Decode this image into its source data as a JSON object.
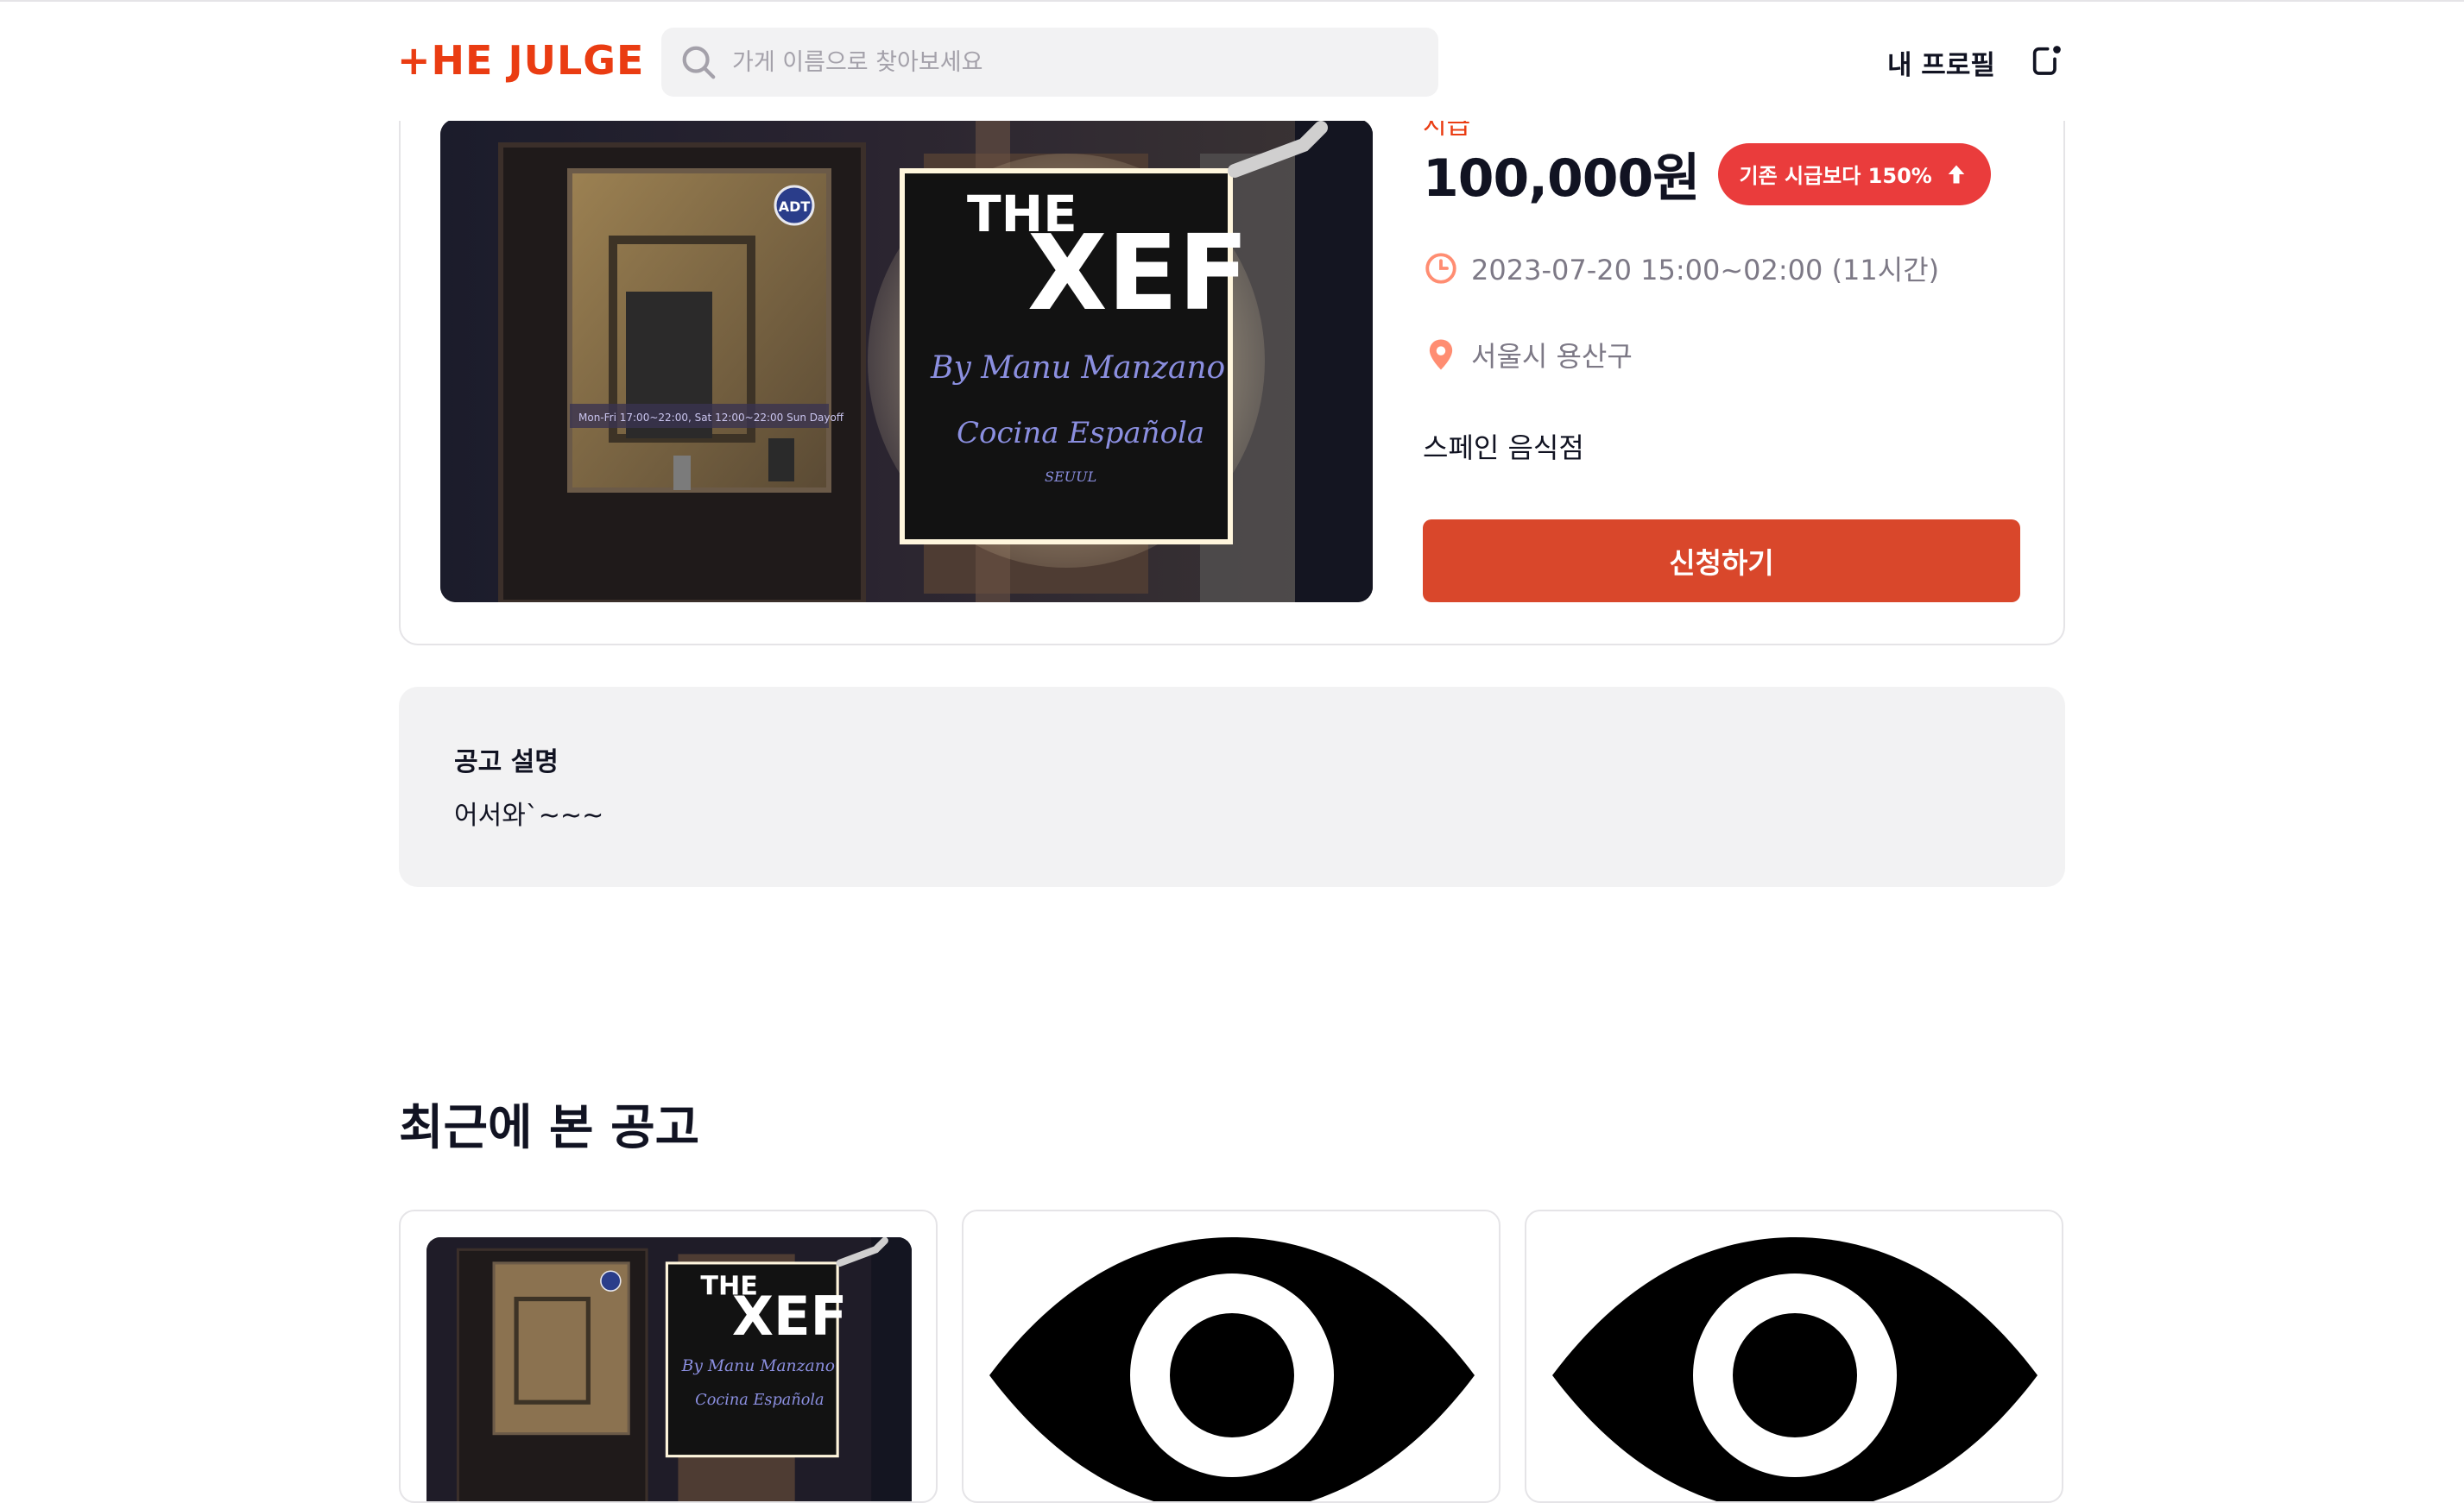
{
  "header": {
    "logo_text": "+HE JULGE",
    "search_placeholder": "가게 이름으로 찾아보세요",
    "profile_label": "내 프로필",
    "brand_color": "#ea3c12"
  },
  "post": {
    "wage_label": "시급",
    "wage": "100,000원",
    "badge": "기존 시급보다 150%",
    "badge_icon": "arrow-up-icon",
    "time": "2023-07-20 15:00~02:00 (11시간)",
    "location": "서울시 용산구",
    "shop_description": "스페인 음식점",
    "apply_label": "신청하기",
    "image": {
      "sign_title_small": "THE",
      "sign_title_big": "XEF",
      "sign_by": "By Manu Manzano",
      "sign_sub": "Cocina Española",
      "sign_city": "SEUUL",
      "door_badge": "ADT",
      "door_hours": "Mon-Fri 17:00~22:00, Sat 12:00~22:00 Sun Dayoff"
    }
  },
  "description": {
    "title": "공고 설명",
    "body": "어서와`~~~"
  },
  "recent": {
    "title": "최근에 본 공고",
    "cards": [
      {
        "thumb": "store-photo"
      },
      {
        "thumb": "eye-icon"
      },
      {
        "thumb": "eye-icon"
      }
    ]
  },
  "colors": {
    "accent": "#ea3c12",
    "apply_button": "#d9472b",
    "badge": "#ea3c3c",
    "icon_orange": "#ff8d72"
  }
}
